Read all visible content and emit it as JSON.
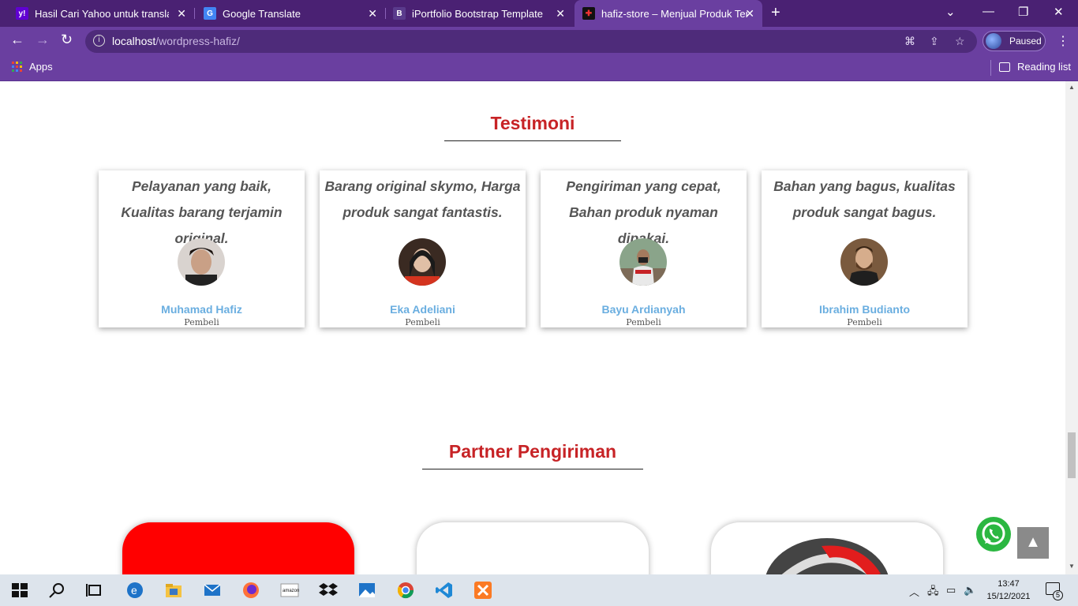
{
  "browser": {
    "tabs": [
      {
        "title": "Hasil Cari Yahoo untuk translate",
        "icon": "yahoo-icon",
        "active": false
      },
      {
        "title": "Google Translate",
        "icon": "google-translate-icon",
        "active": false
      },
      {
        "title": "iPortfolio Bootstrap Template - In",
        "icon": "bootstrap-icon",
        "active": false
      },
      {
        "title": "hafiz-store – Menjual Produk Terb",
        "icon": "store-favicon-icon",
        "active": true
      }
    ],
    "url_host": "localhost",
    "url_path": "/wordpress-hafiz/",
    "profile_status": "Paused",
    "bookmarks": {
      "apps_label": "Apps",
      "reading_list_label": "Reading list"
    }
  },
  "testimoni": {
    "title": "Testimoni",
    "cards": [
      {
        "quote": "Pelayanan yang baik, Kualitas barang terjamin original.",
        "name": "Muhamad Hafiz",
        "role": "Pembeli"
      },
      {
        "quote": "Barang original skymo, Harga produk sangat fantastis.",
        "name": "Eka Adeliani",
        "role": "Pembeli"
      },
      {
        "quote": "Pengiriman yang cepat, Bahan produk nyaman dipakai.",
        "name": "Bayu Ardianyah",
        "role": "Pembeli"
      },
      {
        "quote": "Bahan yang bagus, kualitas produk sangat bagus.",
        "name": "Ibrahim Budianto",
        "role": "Pembeli"
      }
    ]
  },
  "partner": {
    "title": "Partner Pengiriman"
  },
  "taskbar": {
    "time": "13:47",
    "date": "15/12/2021",
    "notification_count": "5"
  },
  "colors": {
    "accent": "#c72326",
    "browser_frame": "#6a3fa0",
    "name_blue": "#6aaee0"
  }
}
